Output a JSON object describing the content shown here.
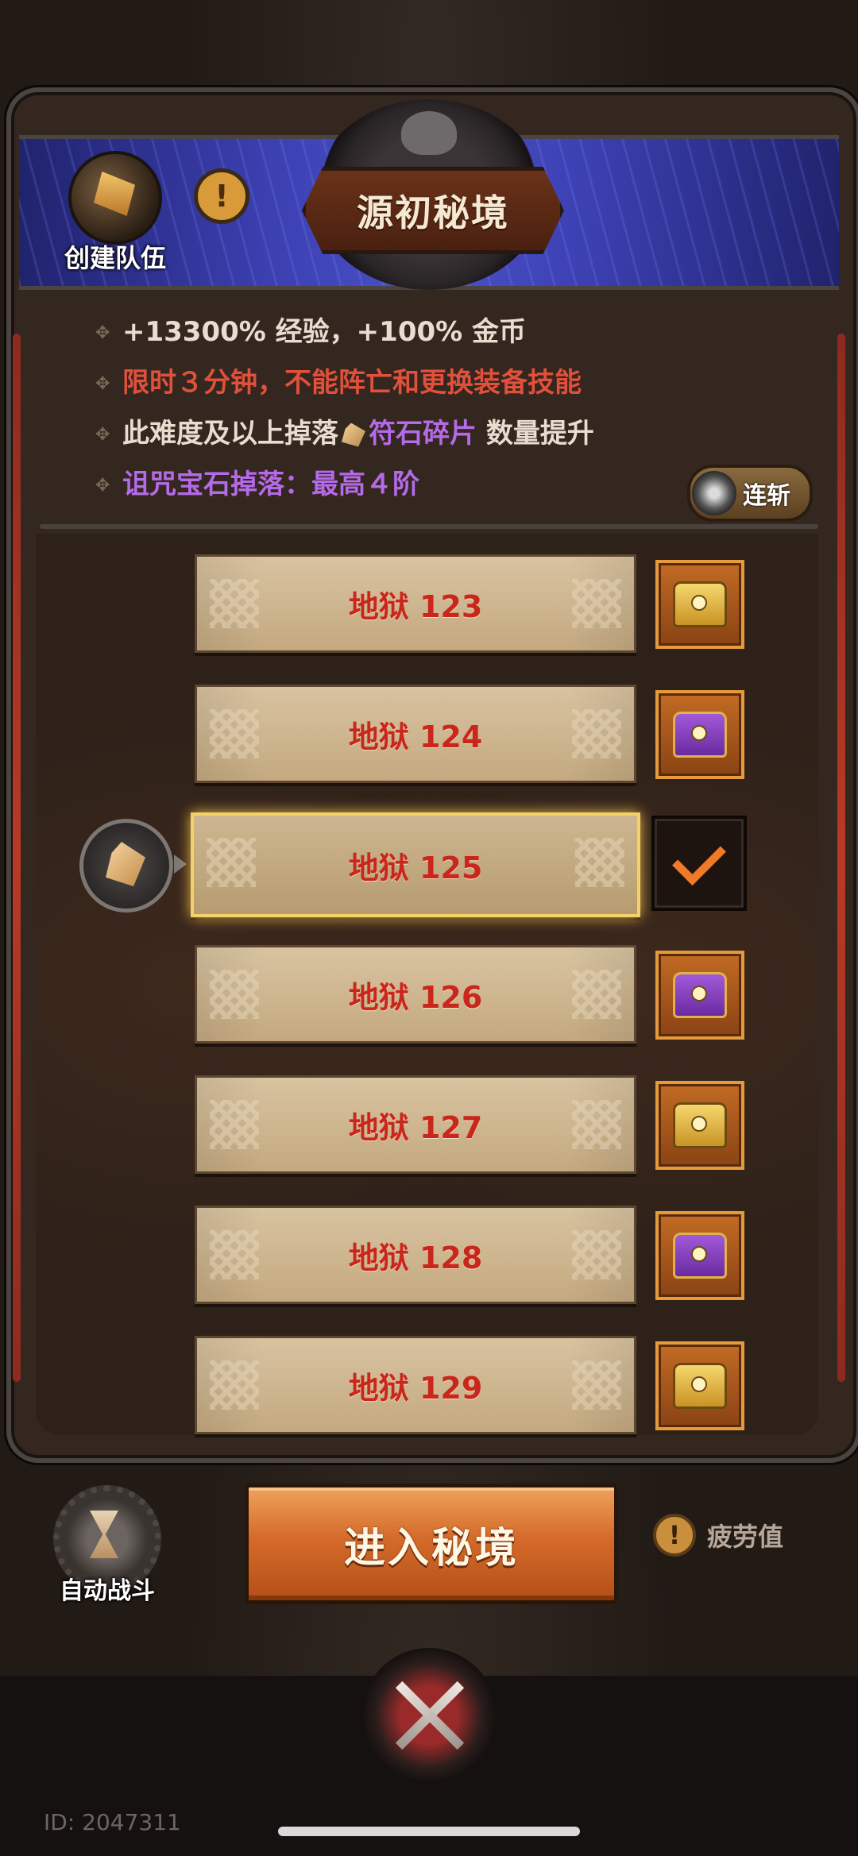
{
  "header": {
    "create_team_label": "创建队伍",
    "title": "源初秘境"
  },
  "info": {
    "line1": "+13300% 经验，+100% 金币",
    "line2": "限时３分钟，不能阵亡和更换装备技能",
    "line3_prefix": "此难度及以上掉落",
    "line3_item": "符石碎片",
    "line3_suffix": "数量提升",
    "line4": "诅咒宝石掉落：最高４阶"
  },
  "combo_label": "连斩",
  "levels": [
    {
      "label": "地狱 123",
      "chest": "gold"
    },
    {
      "label": "地狱 124",
      "chest": "purple"
    },
    {
      "label": "地狱 125",
      "chest": "checked"
    },
    {
      "label": "地狱 126",
      "chest": "purple"
    },
    {
      "label": "地狱 127",
      "chest": "gold"
    },
    {
      "label": "地狱 128",
      "chest": "purple"
    },
    {
      "label": "地狱 129",
      "chest": "gold"
    }
  ],
  "selected_level": "地狱 125",
  "bottom": {
    "auto_battle_label": "自动战斗",
    "enter_label": "进入秘境",
    "fatigue_label": "疲劳值",
    "warn_glyph": "!"
  },
  "user_id": "ID: 2047311",
  "colors": {
    "info_white": "#e9ddd0",
    "info_red": "#e0503a",
    "info_purple": "#b56ae8",
    "level_text": "#c9261c",
    "accent_orange": "#d46b2a"
  }
}
